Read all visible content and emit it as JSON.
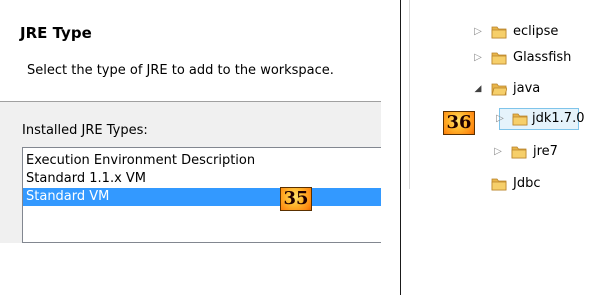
{
  "left": {
    "title": "JRE Type",
    "subtitle": "Select the type of JRE to add to the workspace.",
    "installed_label": "Installed JRE Types:",
    "list": [
      {
        "label": "Execution Environment Description",
        "selected": false
      },
      {
        "label": "Standard 1.1.x VM",
        "selected": false
      },
      {
        "label": "Standard VM",
        "selected": true
      }
    ]
  },
  "badges": {
    "left": "35",
    "right": "36"
  },
  "tree": {
    "items": [
      {
        "label": "eclipse",
        "state": "collapsed",
        "icon": "folder-icon"
      },
      {
        "label": "Glassfish",
        "state": "collapsed",
        "icon": "folder-icon"
      },
      {
        "label": "java",
        "state": "expanded",
        "icon": "folder-icon"
      },
      {
        "label": "jdk1.7.0",
        "state": "collapsed",
        "selected": true,
        "icon": "folder-icon"
      },
      {
        "label": "jre7",
        "state": "collapsed",
        "icon": "folder-icon"
      },
      {
        "label": "Jdbc",
        "state": "leaf",
        "icon": "folder-icon"
      }
    ]
  },
  "colors": {
    "selection": "#3399ff",
    "tree_selection_bg": "#e5f3fb",
    "tree_selection_border": "#7fc4ea",
    "folder": "#e8b54a",
    "badge": "#ff9a1f"
  }
}
